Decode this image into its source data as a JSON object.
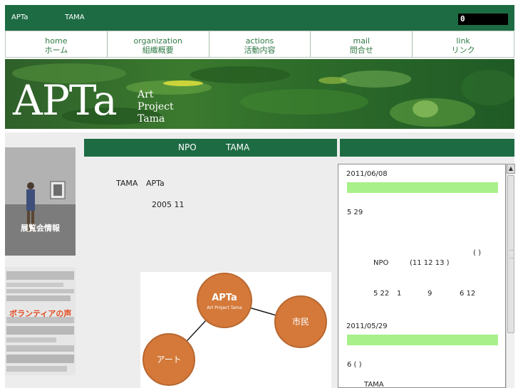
{
  "topbar": {
    "brand": "APTa",
    "subtitle": "TAMA",
    "counter": "0"
  },
  "nav": [
    {
      "en": "home",
      "jp": "ホーム"
    },
    {
      "en": "organization",
      "jp": "組織概要"
    },
    {
      "en": "actions",
      "jp": "活動内容"
    },
    {
      "en": "mail",
      "jp": "問合せ"
    },
    {
      "en": "link",
      "jp": "リンク"
    }
  ],
  "banner": {
    "logo_big": "APTa",
    "logo_line1": "Art",
    "logo_line2": "Project",
    "logo_line3": "Tama"
  },
  "sidebar": {
    "exhibition_label": "展覧会情報",
    "volunteer_label": "ボランティアの声"
  },
  "main": {
    "title_left": "NPO",
    "title_right": "TAMA",
    "intro_1a": "TAMA",
    "intro_1b": "APTa",
    "intro_2": "2005 11"
  },
  "diagram": {
    "center_title": "APTa",
    "center_subtitle": "Art Project Tama",
    "right_node": "市民",
    "left_node": "アート"
  },
  "news": {
    "date_1": "2011/06/08",
    "text_1": "5 29",
    "text_2": "( )",
    "text_3a": "NPO",
    "text_3b": "(11 12 13 )",
    "text_4a": "5 22",
    "text_4b": "1",
    "text_4c": "9",
    "text_4d": "6 12",
    "date_2": "2011/05/29",
    "text_5": "6 ( )",
    "text_6": "TAMA"
  },
  "colors": {
    "primary_green": "#1d6b43",
    "news_bar": "#a8f089",
    "diagram_node": "#d4793a"
  }
}
